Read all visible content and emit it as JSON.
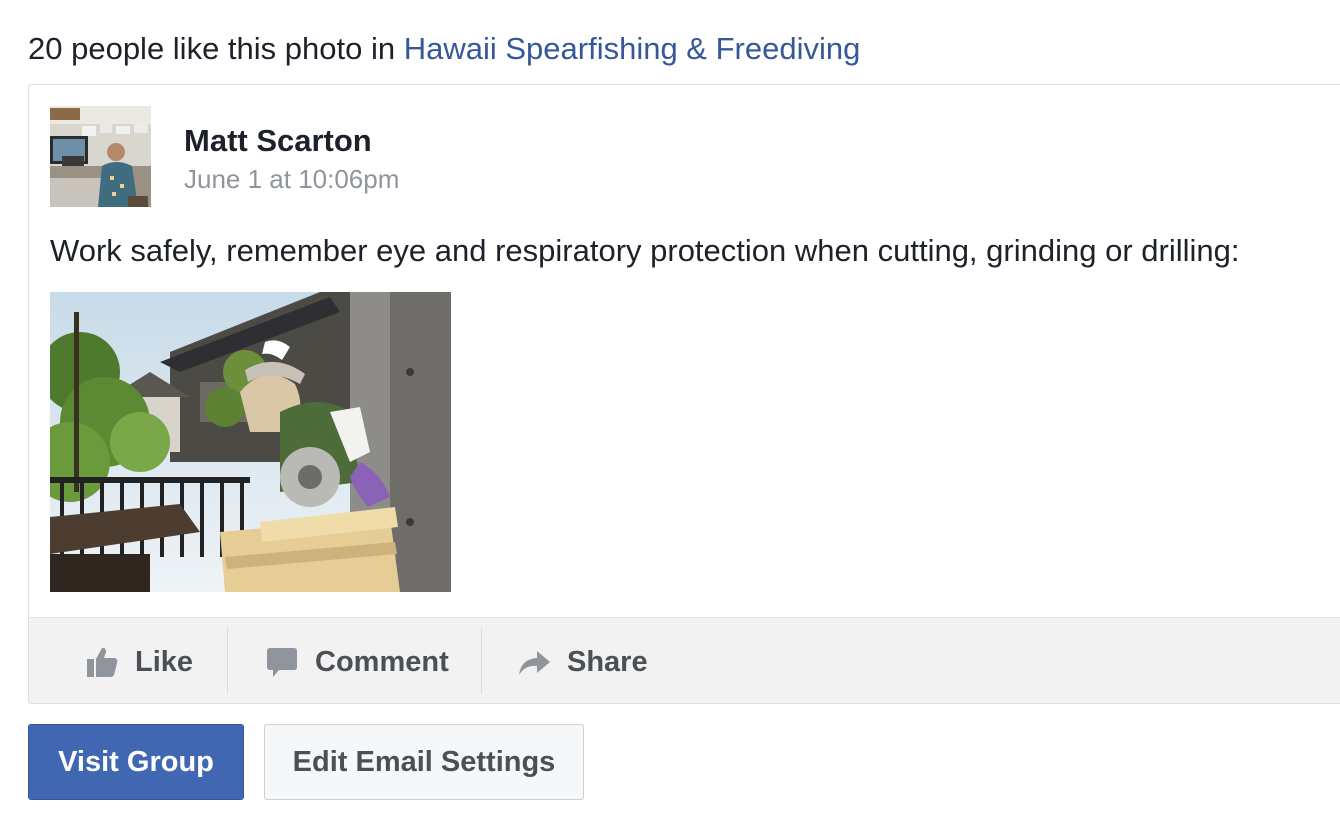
{
  "headline": {
    "prefix": "20 people like this photo in ",
    "group_link": "Hawaii Spearfishing & Freediving"
  },
  "post": {
    "author": "Matt Scarton",
    "timestamp": "June 1 at 10:06pm",
    "text": "Work safely, remember eye and respiratory protection when cutting, grinding or drilling:"
  },
  "actions": {
    "like": "Like",
    "comment": "Comment",
    "share": "Share"
  },
  "buttons": {
    "visit_group": "Visit Group",
    "edit_email_settings": "Edit Email Settings"
  },
  "icons": {
    "like": "thumbs-up-icon",
    "comment": "speech-bubble-icon",
    "share": "share-arrow-icon"
  },
  "colors": {
    "link": "#365899",
    "primary_button": "#4267b2",
    "secondary_text": "#90949c",
    "icon_gray": "#90949c"
  }
}
